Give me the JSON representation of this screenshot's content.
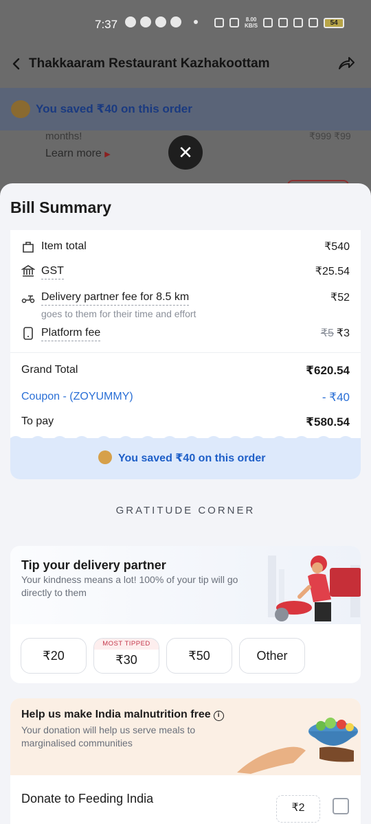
{
  "status_bar": {
    "time": "7:37",
    "net_speed_value": "8.00",
    "net_speed_unit": "KB/S",
    "battery": "54"
  },
  "header": {
    "title": "Thakkaaram Restaurant Kazhakoottam"
  },
  "saved_banner": {
    "text": "You saved ₹40 on this order"
  },
  "background_offer": {
    "months_text": "months!",
    "learn_more": "Learn more",
    "strike_price": "₹999 ₹99"
  },
  "bill_summary": {
    "title": "Bill Summary",
    "items": [
      {
        "label": "Item total",
        "value": "₹540",
        "icon": "bag-icon"
      },
      {
        "label": "GST",
        "value": "₹25.54",
        "icon": "bank-icon"
      },
      {
        "label": "Delivery partner fee for 8.5 km",
        "value": "₹52",
        "sub": "goes to them for their time and effort",
        "icon": "scooter-icon"
      },
      {
        "label": "Platform fee",
        "value_strike": "₹5",
        "value": "₹3",
        "icon": "phone-icon"
      }
    ],
    "grand_total_label": "Grand Total",
    "grand_total_value": "₹620.54",
    "coupon_label": "Coupon - (ZOYUMMY)",
    "coupon_value": "- ₹40",
    "to_pay_label": "To pay",
    "to_pay_value": "₹580.54",
    "savings_text": "You saved ₹40 on this order"
  },
  "gratitude_heading": "GRATITUDE CORNER",
  "tip": {
    "title": "Tip your delivery partner",
    "description": "Your kindness means a lot! 100% of your tip will go directly to them",
    "options": [
      "₹20",
      "₹30",
      "₹50",
      "Other"
    ],
    "most_tipped_badge": "MOST TIPPED"
  },
  "donation": {
    "title": "Help us make India malnutrition free",
    "description": "Your donation will help us serve meals to marginalised communities",
    "row_label": "Donate to Feeding India",
    "amount": "₹2"
  }
}
